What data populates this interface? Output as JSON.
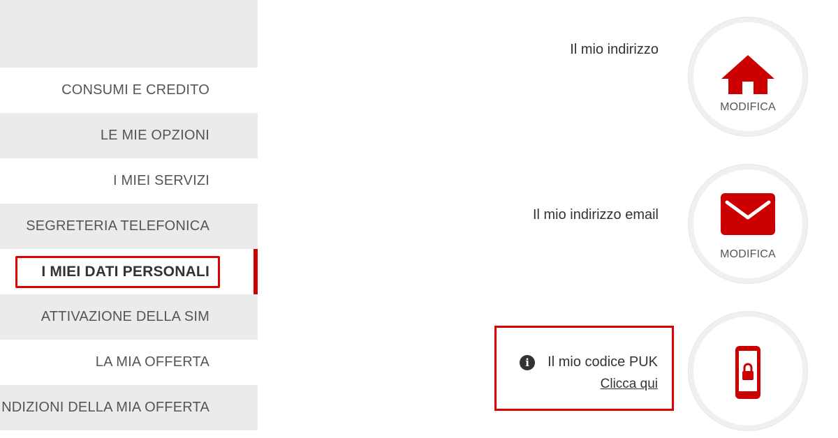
{
  "sidebar": {
    "items": [
      {
        "label": "CONSUMI E CREDITO"
      },
      {
        "label": "LE MIE OPZIONI"
      },
      {
        "label": "I MIEI SERVIZI"
      },
      {
        "label": "SEGRETERIA TELEFONICA"
      },
      {
        "label": "I MIEI DATI PERSONALI",
        "active": true
      },
      {
        "label": "ATTIVAZIONE DELLA SIM"
      },
      {
        "label": "LA MIA OFFERTA"
      },
      {
        "label": "NDIZIONI DELLA MIA OFFERTA"
      }
    ]
  },
  "main": {
    "address": {
      "label": "Il mio indirizzo",
      "action": "MODIFICA",
      "icon": "home-icon"
    },
    "email": {
      "label": "Il mio indirizzo email",
      "action": "MODIFICA",
      "icon": "envelope-icon"
    },
    "puk": {
      "label": "Il mio codice PUK",
      "link": "Clicca qui",
      "icon": "phone-lock-icon",
      "info_icon": "info-icon"
    }
  },
  "colors": {
    "accent": "#cc0000",
    "highlight_border": "#dd0000",
    "sidebar_gray": "#ebebeb",
    "text": "#555555"
  }
}
